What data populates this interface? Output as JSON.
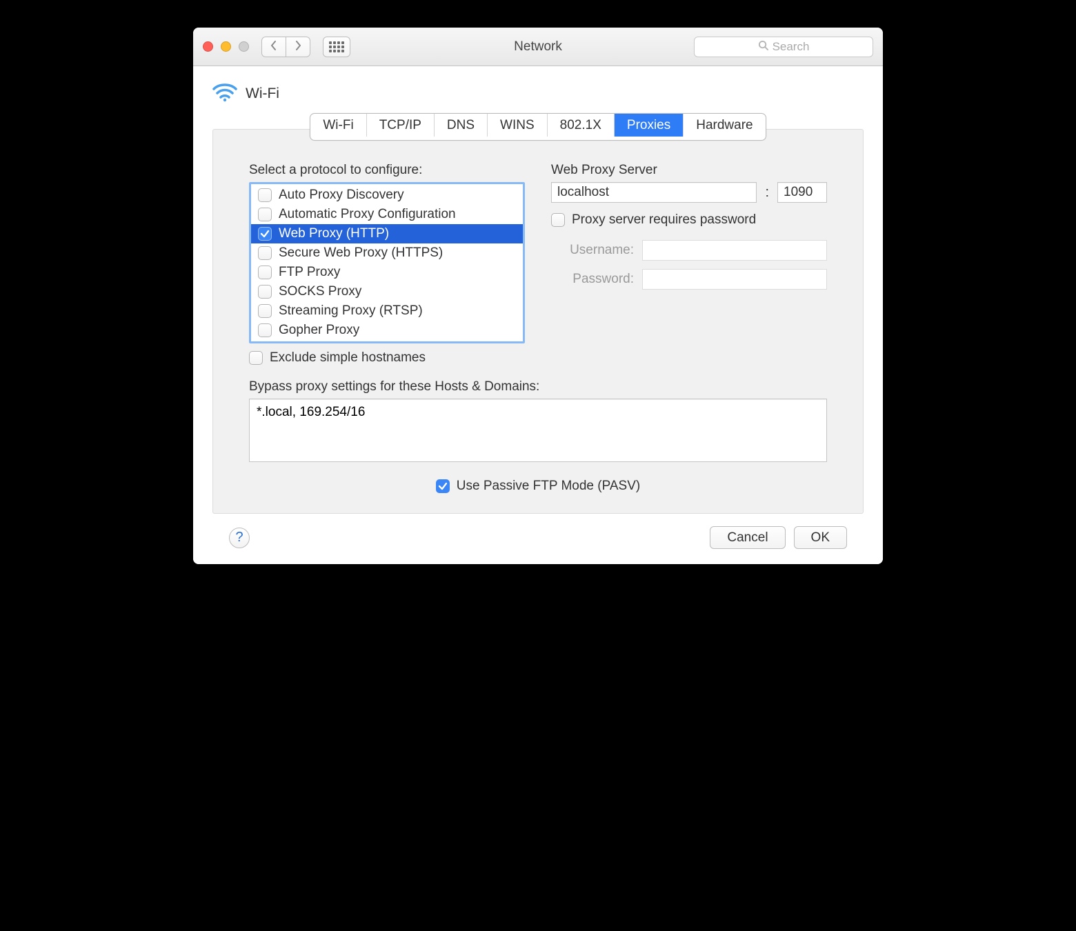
{
  "window": {
    "title": "Network",
    "search_placeholder": "Search"
  },
  "connection": {
    "name": "Wi-Fi"
  },
  "tabs": [
    {
      "label": "Wi-Fi"
    },
    {
      "label": "TCP/IP"
    },
    {
      "label": "DNS"
    },
    {
      "label": "WINS"
    },
    {
      "label": "802.1X"
    },
    {
      "label": "Proxies"
    },
    {
      "label": "Hardware"
    }
  ],
  "selected_tab_index": 5,
  "left": {
    "heading": "Select a protocol to configure:",
    "protocols": [
      {
        "label": "Auto Proxy Discovery",
        "checked": false
      },
      {
        "label": "Automatic Proxy Configuration",
        "checked": false
      },
      {
        "label": "Web Proxy (HTTP)",
        "checked": true
      },
      {
        "label": "Secure Web Proxy (HTTPS)",
        "checked": false
      },
      {
        "label": "FTP Proxy",
        "checked": false
      },
      {
        "label": "SOCKS Proxy",
        "checked": false
      },
      {
        "label": "Streaming Proxy (RTSP)",
        "checked": false
      },
      {
        "label": "Gopher Proxy",
        "checked": false
      }
    ],
    "selected_index": 2,
    "exclude_simple_label": "Exclude simple hostnames",
    "exclude_simple_checked": false
  },
  "right": {
    "heading": "Web Proxy Server",
    "host": "localhost",
    "port": "1090",
    "requires_password_label": "Proxy server requires password",
    "requires_password_checked": false,
    "username_label": "Username:",
    "password_label": "Password:",
    "username": "",
    "password": ""
  },
  "bypass": {
    "heading": "Bypass proxy settings for these Hosts & Domains:",
    "value": "*.local, 169.254/16"
  },
  "pasv": {
    "label": "Use Passive FTP Mode (PASV)",
    "checked": true
  },
  "footer": {
    "help": "?",
    "cancel": "Cancel",
    "ok": "OK"
  }
}
